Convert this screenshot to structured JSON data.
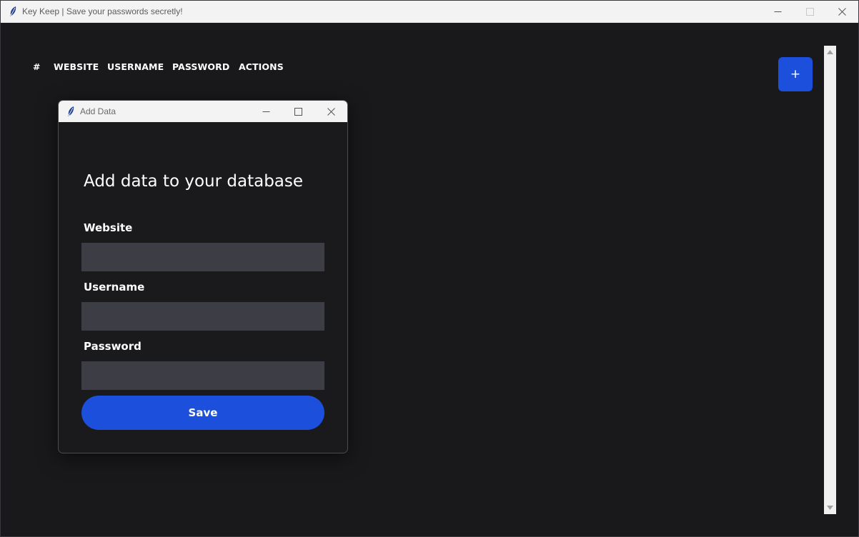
{
  "main_window": {
    "title": "Key Keep | Save your passwords secretly!",
    "app_icon": "feather-icon",
    "controls": [
      "minimize-icon",
      "maximize-icon",
      "close-icon"
    ]
  },
  "table": {
    "columns": [
      "#",
      "WEBSITE",
      "USERNAME",
      "PASSWORD",
      "ACTIONS"
    ]
  },
  "add_button": {
    "label": "+"
  },
  "dialog": {
    "title": "Add Data",
    "app_icon": "feather-icon",
    "heading": "Add data to your database",
    "fields": [
      {
        "label": "Website",
        "value": "",
        "placeholder": ""
      },
      {
        "label": "Username",
        "value": "",
        "placeholder": ""
      },
      {
        "label": "Password",
        "value": "",
        "placeholder": ""
      }
    ],
    "save_label": "Save"
  },
  "colors": {
    "background": "#19191b",
    "accent": "#1c4fdb",
    "input_bg": "#3d3e45",
    "titlebar": "#f3f3f3"
  }
}
